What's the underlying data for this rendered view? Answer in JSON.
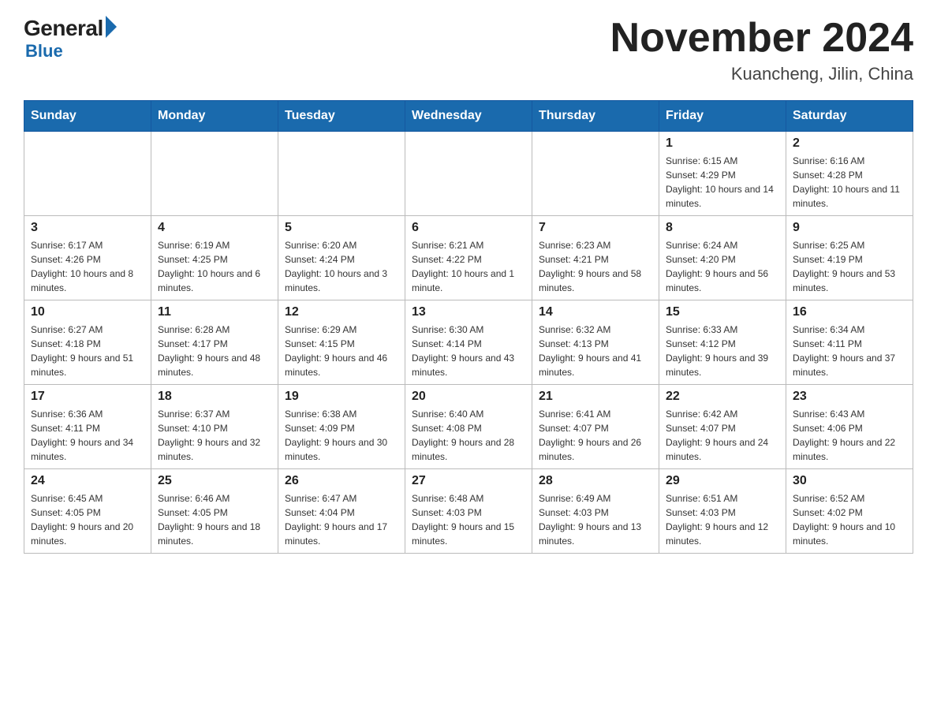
{
  "header": {
    "month_year": "November 2024",
    "location": "Kuancheng, Jilin, China"
  },
  "days_of_week": [
    "Sunday",
    "Monday",
    "Tuesday",
    "Wednesday",
    "Thursday",
    "Friday",
    "Saturday"
  ],
  "weeks": [
    [
      {
        "day": "",
        "info": ""
      },
      {
        "day": "",
        "info": ""
      },
      {
        "day": "",
        "info": ""
      },
      {
        "day": "",
        "info": ""
      },
      {
        "day": "",
        "info": ""
      },
      {
        "day": "1",
        "info": "Sunrise: 6:15 AM\nSunset: 4:29 PM\nDaylight: 10 hours and 14 minutes."
      },
      {
        "day": "2",
        "info": "Sunrise: 6:16 AM\nSunset: 4:28 PM\nDaylight: 10 hours and 11 minutes."
      }
    ],
    [
      {
        "day": "3",
        "info": "Sunrise: 6:17 AM\nSunset: 4:26 PM\nDaylight: 10 hours and 8 minutes."
      },
      {
        "day": "4",
        "info": "Sunrise: 6:19 AM\nSunset: 4:25 PM\nDaylight: 10 hours and 6 minutes."
      },
      {
        "day": "5",
        "info": "Sunrise: 6:20 AM\nSunset: 4:24 PM\nDaylight: 10 hours and 3 minutes."
      },
      {
        "day": "6",
        "info": "Sunrise: 6:21 AM\nSunset: 4:22 PM\nDaylight: 10 hours and 1 minute."
      },
      {
        "day": "7",
        "info": "Sunrise: 6:23 AM\nSunset: 4:21 PM\nDaylight: 9 hours and 58 minutes."
      },
      {
        "day": "8",
        "info": "Sunrise: 6:24 AM\nSunset: 4:20 PM\nDaylight: 9 hours and 56 minutes."
      },
      {
        "day": "9",
        "info": "Sunrise: 6:25 AM\nSunset: 4:19 PM\nDaylight: 9 hours and 53 minutes."
      }
    ],
    [
      {
        "day": "10",
        "info": "Sunrise: 6:27 AM\nSunset: 4:18 PM\nDaylight: 9 hours and 51 minutes."
      },
      {
        "day": "11",
        "info": "Sunrise: 6:28 AM\nSunset: 4:17 PM\nDaylight: 9 hours and 48 minutes."
      },
      {
        "day": "12",
        "info": "Sunrise: 6:29 AM\nSunset: 4:15 PM\nDaylight: 9 hours and 46 minutes."
      },
      {
        "day": "13",
        "info": "Sunrise: 6:30 AM\nSunset: 4:14 PM\nDaylight: 9 hours and 43 minutes."
      },
      {
        "day": "14",
        "info": "Sunrise: 6:32 AM\nSunset: 4:13 PM\nDaylight: 9 hours and 41 minutes."
      },
      {
        "day": "15",
        "info": "Sunrise: 6:33 AM\nSunset: 4:12 PM\nDaylight: 9 hours and 39 minutes."
      },
      {
        "day": "16",
        "info": "Sunrise: 6:34 AM\nSunset: 4:11 PM\nDaylight: 9 hours and 37 minutes."
      }
    ],
    [
      {
        "day": "17",
        "info": "Sunrise: 6:36 AM\nSunset: 4:11 PM\nDaylight: 9 hours and 34 minutes."
      },
      {
        "day": "18",
        "info": "Sunrise: 6:37 AM\nSunset: 4:10 PM\nDaylight: 9 hours and 32 minutes."
      },
      {
        "day": "19",
        "info": "Sunrise: 6:38 AM\nSunset: 4:09 PM\nDaylight: 9 hours and 30 minutes."
      },
      {
        "day": "20",
        "info": "Sunrise: 6:40 AM\nSunset: 4:08 PM\nDaylight: 9 hours and 28 minutes."
      },
      {
        "day": "21",
        "info": "Sunrise: 6:41 AM\nSunset: 4:07 PM\nDaylight: 9 hours and 26 minutes."
      },
      {
        "day": "22",
        "info": "Sunrise: 6:42 AM\nSunset: 4:07 PM\nDaylight: 9 hours and 24 minutes."
      },
      {
        "day": "23",
        "info": "Sunrise: 6:43 AM\nSunset: 4:06 PM\nDaylight: 9 hours and 22 minutes."
      }
    ],
    [
      {
        "day": "24",
        "info": "Sunrise: 6:45 AM\nSunset: 4:05 PM\nDaylight: 9 hours and 20 minutes."
      },
      {
        "day": "25",
        "info": "Sunrise: 6:46 AM\nSunset: 4:05 PM\nDaylight: 9 hours and 18 minutes."
      },
      {
        "day": "26",
        "info": "Sunrise: 6:47 AM\nSunset: 4:04 PM\nDaylight: 9 hours and 17 minutes."
      },
      {
        "day": "27",
        "info": "Sunrise: 6:48 AM\nSunset: 4:03 PM\nDaylight: 9 hours and 15 minutes."
      },
      {
        "day": "28",
        "info": "Sunrise: 6:49 AM\nSunset: 4:03 PM\nDaylight: 9 hours and 13 minutes."
      },
      {
        "day": "29",
        "info": "Sunrise: 6:51 AM\nSunset: 4:03 PM\nDaylight: 9 hours and 12 minutes."
      },
      {
        "day": "30",
        "info": "Sunrise: 6:52 AM\nSunset: 4:02 PM\nDaylight: 9 hours and 10 minutes."
      }
    ]
  ]
}
